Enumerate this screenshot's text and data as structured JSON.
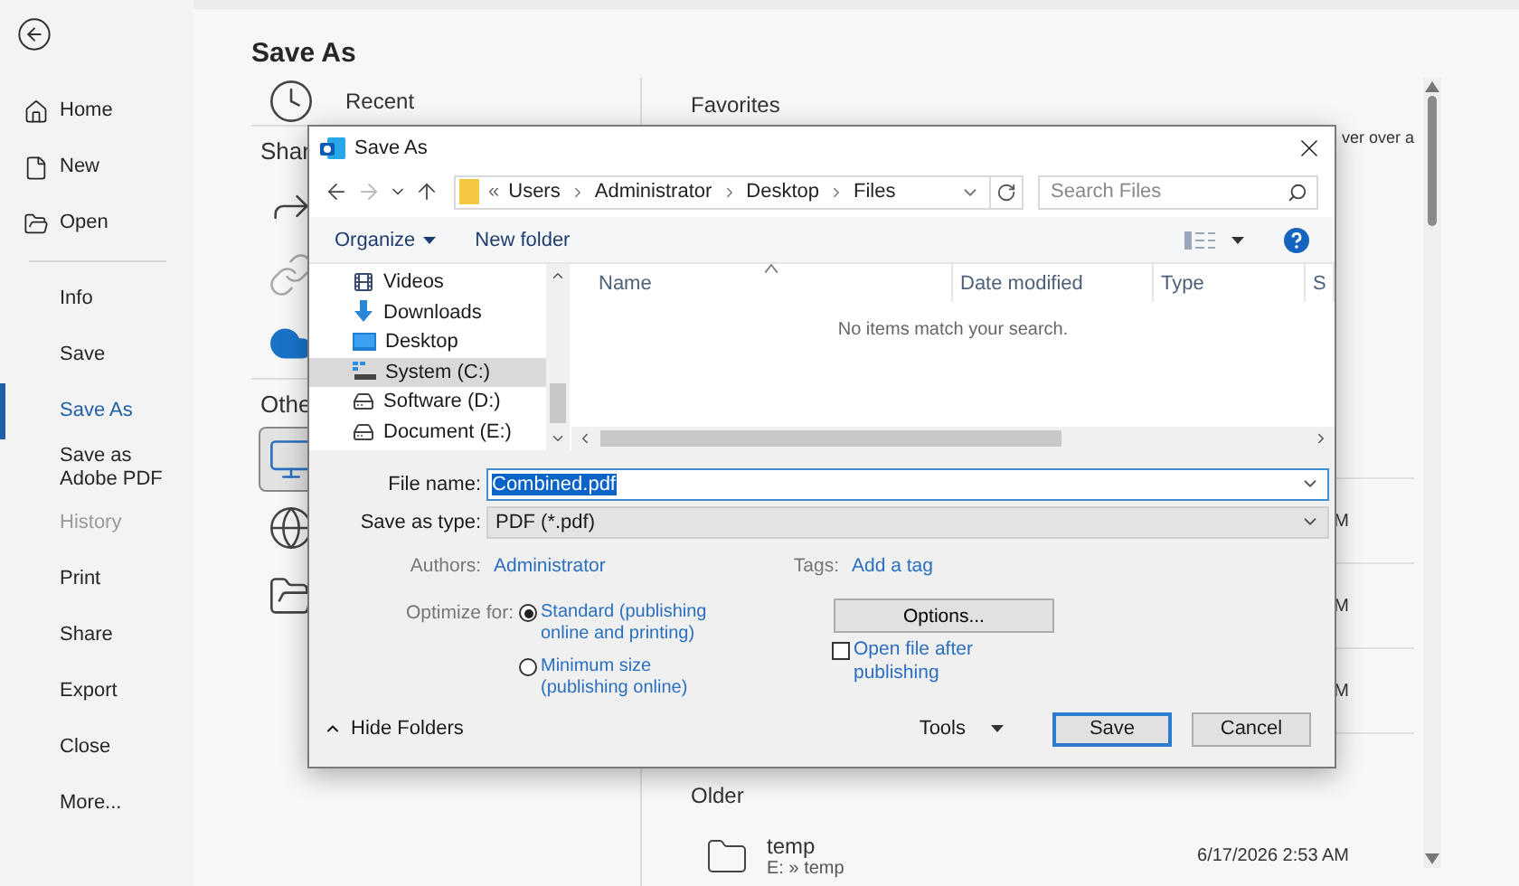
{
  "sidebar": {
    "items": [
      {
        "kind": "home",
        "label": "Home",
        "selected": false,
        "disabled": false
      },
      {
        "kind": "new",
        "label": "New",
        "selected": false,
        "disabled": false
      },
      {
        "kind": "open",
        "label": "Open",
        "selected": false,
        "disabled": false
      },
      {
        "kind": "divider"
      },
      {
        "kind": "plain",
        "label": "Info",
        "selected": false,
        "disabled": false
      },
      {
        "kind": "plain",
        "label": "Save",
        "selected": false,
        "disabled": false
      },
      {
        "kind": "plain",
        "label": "Save As",
        "selected": true,
        "disabled": false
      },
      {
        "kind": "plain",
        "label": "Save as Adobe PDF",
        "selected": false,
        "disabled": false
      },
      {
        "kind": "plain",
        "label": "History",
        "selected": false,
        "disabled": true
      },
      {
        "kind": "plain",
        "label": "Print",
        "selected": false,
        "disabled": false
      },
      {
        "kind": "plain",
        "label": "Share",
        "selected": false,
        "disabled": false
      },
      {
        "kind": "plain",
        "label": "Export",
        "selected": false,
        "disabled": false
      },
      {
        "kind": "plain",
        "label": "Close",
        "selected": false,
        "disabled": false
      },
      {
        "kind": "plain",
        "label": "More...",
        "selected": false,
        "disabled": false
      }
    ]
  },
  "page_title": "Save As",
  "locations": [
    {
      "kind": "recent",
      "label": "Recent",
      "selected": false
    },
    {
      "kind": "header",
      "label": "Shar"
    },
    {
      "kind": "share",
      "selected": false
    },
    {
      "kind": "link",
      "selected": false
    },
    {
      "kind": "cloud",
      "selected": false
    },
    {
      "kind": "header",
      "label": "Othe"
    },
    {
      "kind": "computer",
      "selected": true
    },
    {
      "kind": "globe",
      "selected": false
    },
    {
      "kind": "folder",
      "selected": false
    }
  ],
  "favorites": {
    "title": "Favorites",
    "rows": [
      {
        "kind": "note",
        "text": "ver over a"
      },
      {
        "kind": "date",
        "text": "M"
      },
      {
        "kind": "date",
        "text": "M"
      },
      {
        "kind": "date",
        "text": "M"
      }
    ]
  },
  "older": {
    "title": "Older",
    "files": [
      {
        "name": "temp",
        "path": "E: » temp",
        "date": "6/17/2026 2:53 AM"
      }
    ]
  },
  "dialog": {
    "title": "Save As",
    "address": {
      "overflow": "«",
      "segments": [
        "Users",
        "Administrator",
        "Desktop",
        "Files"
      ]
    },
    "search": {
      "placeholder": "Search Files"
    },
    "toolbar": {
      "organize": "Organize",
      "new_folder": "New folder"
    },
    "nav_items": [
      {
        "kind": "videos",
        "label": "Videos",
        "selected": false
      },
      {
        "kind": "downloads",
        "label": "Downloads",
        "selected": false
      },
      {
        "kind": "desktop",
        "label": "Desktop",
        "selected": false
      },
      {
        "kind": "system_drive",
        "label": "System (C:)",
        "selected": true
      },
      {
        "kind": "drive",
        "label": "Software (D:)",
        "selected": false
      },
      {
        "kind": "drive",
        "label": "Document (E:)",
        "selected": false
      }
    ],
    "columns": [
      "Name",
      "Date modified",
      "Type",
      "S"
    ],
    "empty_message": "No items match your search.",
    "file_name": {
      "label": "File name:",
      "value": "Combined.pdf"
    },
    "save_as_type": {
      "label": "Save as type:",
      "value": "PDF (*.pdf)"
    },
    "authors": {
      "label": "Authors:",
      "value": "Administrator"
    },
    "tags": {
      "label": "Tags:",
      "value": "Add a tag"
    },
    "optimize": {
      "label": "Optimize for:",
      "options": [
        {
          "label": "Standard (publishing online and printing)",
          "selected": true
        },
        {
          "label": "Minimum size (publishing online)",
          "selected": false
        }
      ]
    },
    "options_button": "Options...",
    "open_after": {
      "label": "Open file after publishing",
      "checked": false
    },
    "hide_folders": "Hide Folders",
    "tools": "Tools",
    "save": "Save",
    "cancel": "Cancel"
  }
}
